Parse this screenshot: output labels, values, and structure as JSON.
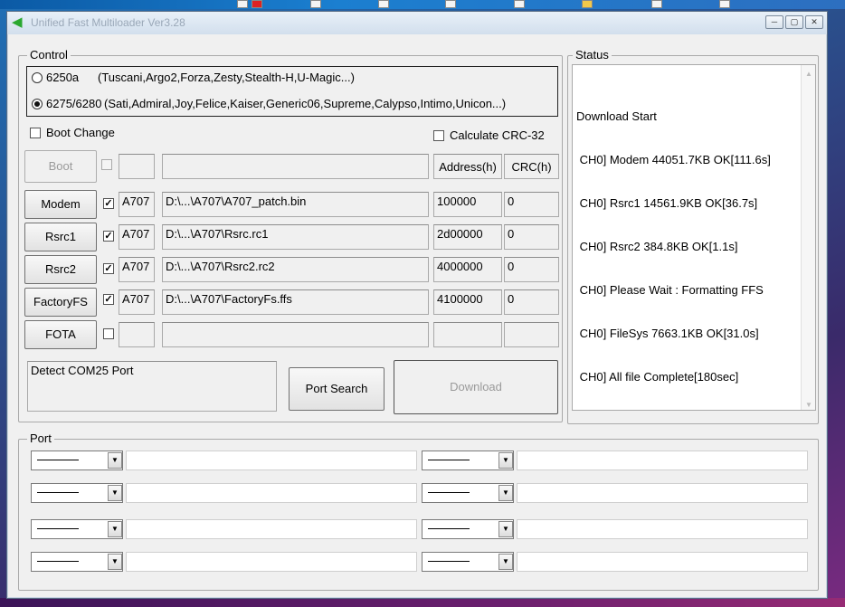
{
  "window": {
    "title": "Unified Fast Multiloader Ver3.28"
  },
  "control": {
    "legend": "Control",
    "radio_options": [
      {
        "value": "6250a",
        "desc": "(Tuscani,Argo2,Forza,Zesty,Stealth-H,U-Magic...)",
        "selected": false
      },
      {
        "value": "6275/6280",
        "desc": "(Sati,Admiral,Joy,Felice,Kaiser,Generic06,Supreme,Calypso,Intimo,Unicon...)",
        "selected": true
      }
    ],
    "boot_change_label": "Boot Change",
    "calc_crc_label": "Calculate CRC-32",
    "address_header": "Address(h)",
    "crc_header": "CRC(h)",
    "rows": [
      {
        "button": "Boot",
        "enabled": false,
        "checked": false,
        "model": "",
        "path": "",
        "address": "",
        "crc": ""
      },
      {
        "button": "Modem",
        "enabled": true,
        "checked": true,
        "model": "A707",
        "path": "D:\\...\\A707\\A707_patch.bin",
        "address": "100000",
        "crc": "0"
      },
      {
        "button": "Rsrc1",
        "enabled": true,
        "checked": true,
        "model": "A707",
        "path": "D:\\...\\A707\\Rsrc.rc1",
        "address": "2d00000",
        "crc": "0"
      },
      {
        "button": "Rsrc2",
        "enabled": true,
        "checked": true,
        "model": "A707",
        "path": "D:\\...\\A707\\Rsrc2.rc2",
        "address": "4000000",
        "crc": "0"
      },
      {
        "button": "FactoryFS",
        "enabled": true,
        "checked": true,
        "model": "A707",
        "path": "D:\\...\\A707\\FactoryFs.ffs",
        "address": "4100000",
        "crc": "0"
      },
      {
        "button": "FOTA",
        "enabled": true,
        "checked": false,
        "model": "",
        "path": "",
        "address": "",
        "crc": ""
      }
    ],
    "detect_text": "Detect COM25 Port",
    "port_search_label": "Port Search",
    "download_label": "Download"
  },
  "status": {
    "legend": "Status",
    "lines": [
      "Download Start",
      " CH0] Modem 44051.7KB OK[111.6s]",
      " CH0] Rsrc1 14561.9KB OK[36.7s]",
      " CH0] Rsrc2 384.8KB OK[1.1s]",
      " CH0] Please Wait : Formatting FFS",
      " CH0] FileSys 7663.1KB OK[31.0s]",
      " CH0] All file Complete[180sec]"
    ]
  },
  "port": {
    "legend": "Port",
    "combo_icon": "chevron-down-icon"
  },
  "colors": {
    "window_bg": "#f0f0f0",
    "title_text": "#9aa8b8",
    "disabled_text": "#9a9a9a"
  }
}
